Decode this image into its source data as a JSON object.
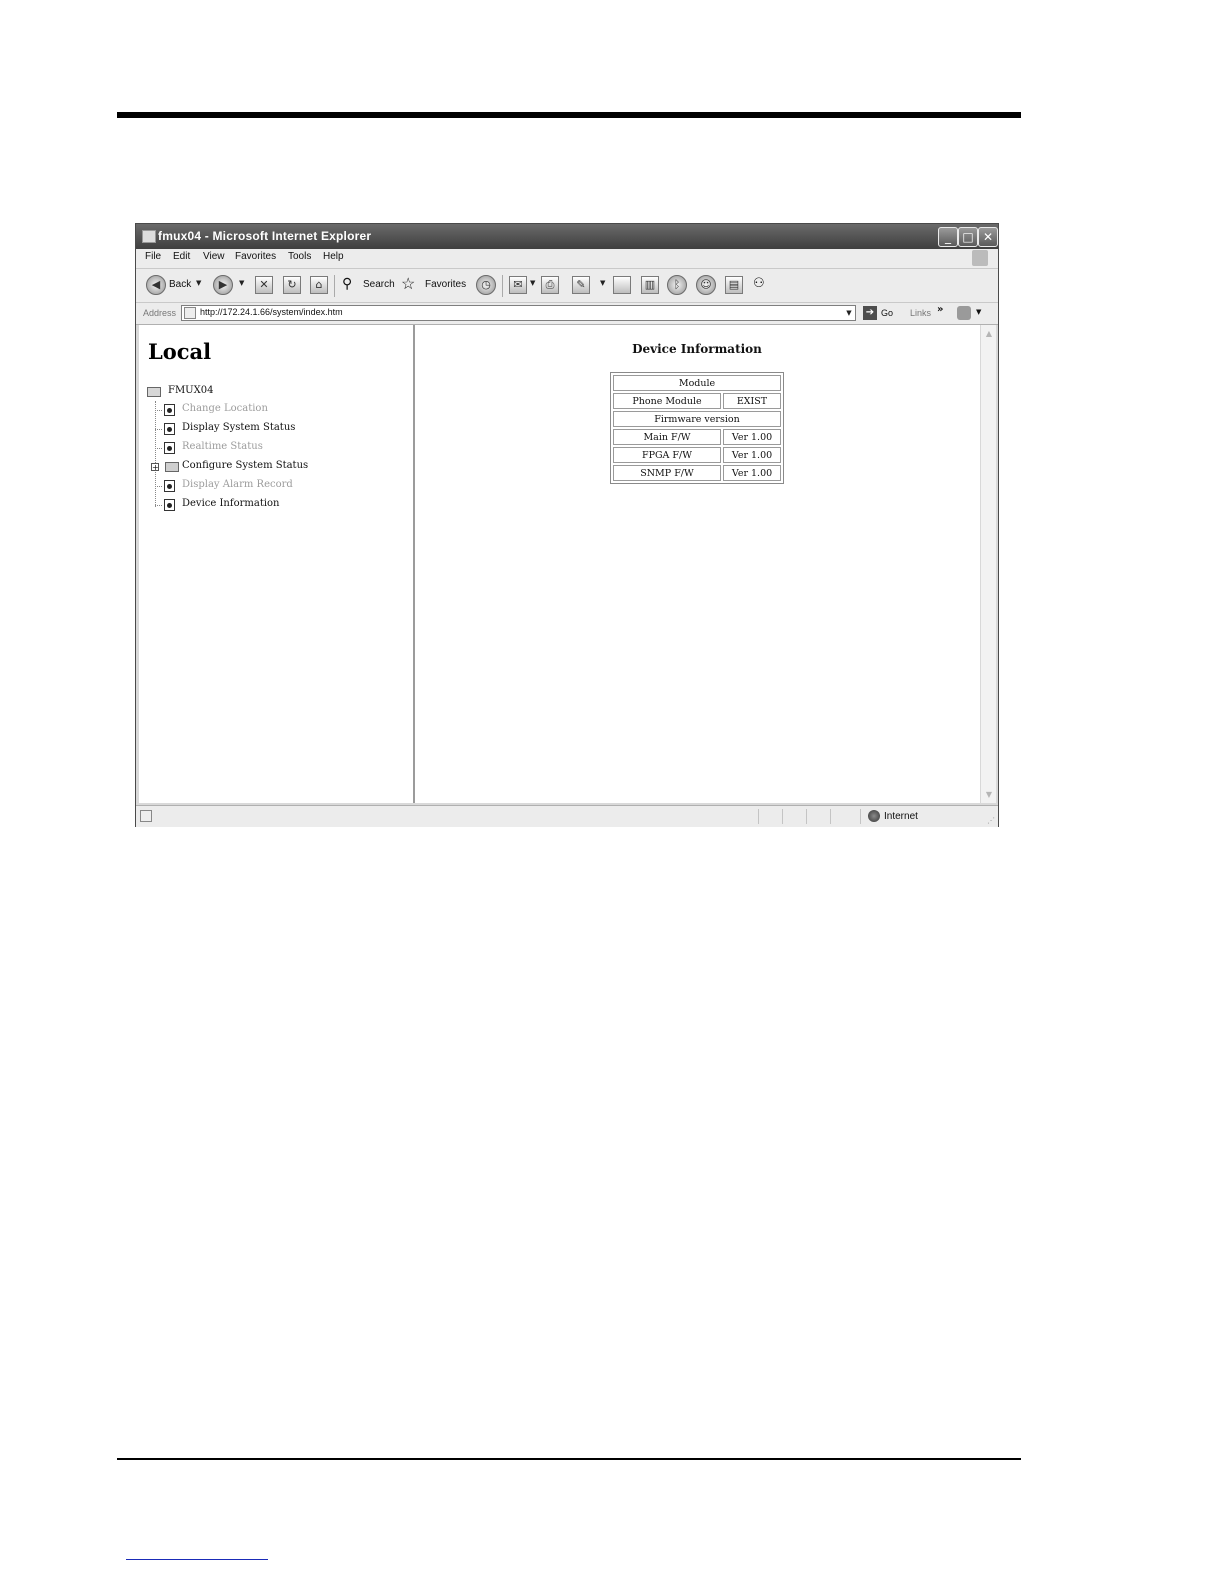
{
  "window": {
    "title": "fmux04 - Microsoft Internet Explorer",
    "min_glyph": "_",
    "max_glyph": "□",
    "close_glyph": "✕"
  },
  "menu": [
    "File",
    "Edit",
    "View",
    "Favorites",
    "Tools",
    "Help"
  ],
  "toolbar": {
    "back_label": "Back",
    "search_label": "Search",
    "favorites_label": "Favorites"
  },
  "address": {
    "label": "Address",
    "url": "http://172.24.1.66/system/index.htm",
    "go_label": "Go",
    "links_label": "Links",
    "links_chevron": "»"
  },
  "left_pane": {
    "heading": "Local",
    "root": "FMUX04",
    "items": [
      {
        "label": "Change Location",
        "dim": true,
        "kind": "page"
      },
      {
        "label": "Display System Status",
        "dim": false,
        "kind": "page"
      },
      {
        "label": "Realtime Status",
        "dim": true,
        "kind": "page"
      },
      {
        "label": "Configure System Status",
        "dim": false,
        "kind": "folder"
      },
      {
        "label": "Display Alarm Record",
        "dim": true,
        "kind": "page"
      },
      {
        "label": "Device Information",
        "dim": false,
        "kind": "page"
      }
    ]
  },
  "device_info": {
    "title": "Device Information",
    "module_header": "Module",
    "phone_module_label": "Phone Module",
    "phone_module_value": "EXIST",
    "firmware_header": "Firmware version",
    "firmware": [
      {
        "name": "Main F/W",
        "version": "Ver 1.00"
      },
      {
        "name": "FPGA F/W",
        "version": "Ver 1.00"
      },
      {
        "name": "SNMP F/W",
        "version": "Ver 1.00"
      }
    ]
  },
  "status": {
    "zone": "Internet"
  }
}
